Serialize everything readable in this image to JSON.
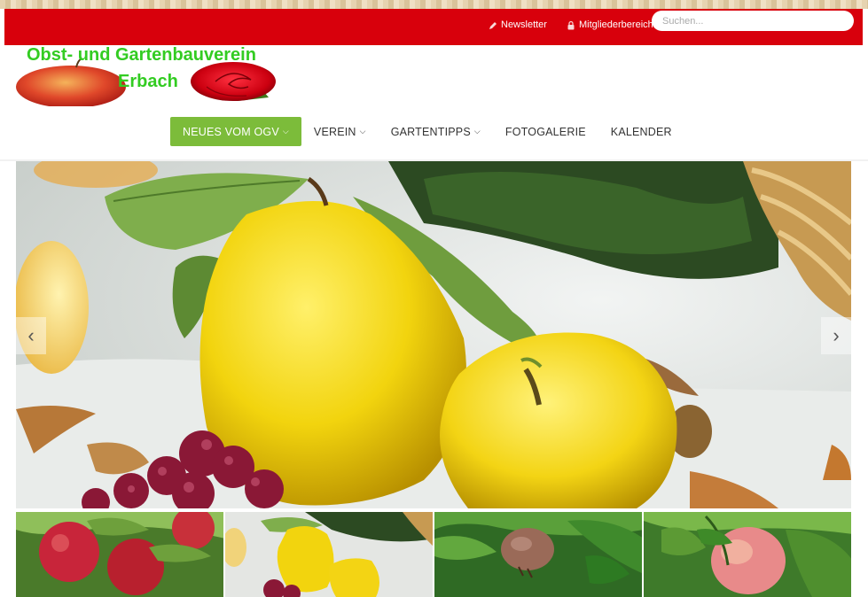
{
  "topbar": {
    "newsletter_label": "Newsletter",
    "members_label": "Mitgliederbereich",
    "search_placeholder": "Suchen..."
  },
  "logo": {
    "line1": "Obst- und Gartenbauverein",
    "line2": "Erbach"
  },
  "nav": {
    "items": [
      {
        "label": "NEUES VOM OGV",
        "active": true,
        "dropdown": true
      },
      {
        "label": "VEREIN",
        "active": false,
        "dropdown": true
      },
      {
        "label": "GARTENTIPPS",
        "active": false,
        "dropdown": true
      },
      {
        "label": "FOTOGALERIE",
        "active": false,
        "dropdown": false
      },
      {
        "label": "KALENDER",
        "active": false,
        "dropdown": false
      }
    ]
  },
  "colors": {
    "topbar": "#d8000c",
    "nav_active": "#7cbc3a",
    "logo_text": "#33cc22"
  },
  "slider": {
    "prev_icon": "chevron-left-icon",
    "next_icon": "chevron-right-icon"
  }
}
